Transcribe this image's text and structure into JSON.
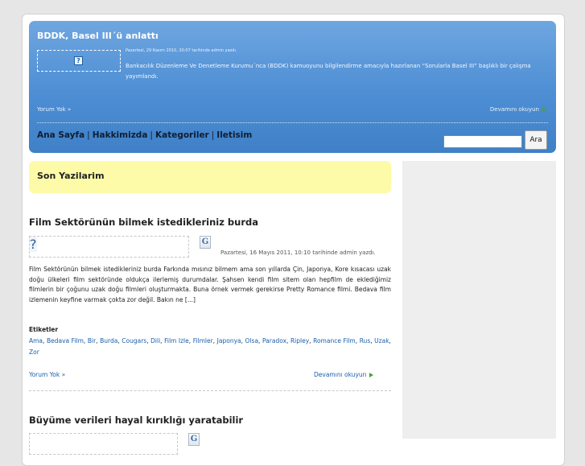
{
  "header": {
    "post_title": "BDDK, Basel III´ü anlattı",
    "post_meta": "Pazartesi, 29 Kasım 2010, 20:07 tarihinde admin yazdı.",
    "post_excerpt": "Bankacılık Düzenleme Ve Denetleme Kurumu´nca (BDDK) kamuoyunu bilgilendirme amacıyla hazırlanan “Sorularla Basel III” başlıklı bir çalışma yayımlandı.",
    "comments_link": "Yorum Yok »",
    "read_more": "Devamını okuyun",
    "image_alt_icon": "broken-image-icon"
  },
  "nav": {
    "items": [
      {
        "label": "Ana Sayfa"
      },
      {
        "label": "Hakkimizda"
      },
      {
        "label": "Kategoriler"
      },
      {
        "label": "Iletisim"
      }
    ],
    "separator": "|"
  },
  "search": {
    "value": "",
    "button_label": "Ara"
  },
  "sections": {
    "recent_title": "Son Yazilarim"
  },
  "posts": [
    {
      "title": "Film Sektörünün bilmek istedikleriniz burda",
      "meta": "Pazartesi, 16 Mayıs 2011, 10:10 tarihinde admin yazdı.",
      "excerpt": "Film Sektörünün bilmek istedikleriniz burda Farkında mısınız bilmem ama son yıllarda Çin, Japonya, Kore kısacası uzak doğu ülkeleri film sektöründe oldukça ilerlemiş durumdalar. Şahsen kendi film sitem olan hepfilm de eklediğimiz filmlerin bir çoğunu uzak doğu filmleri oluşturmakta. Buna örnek vermek gerekirse Pretty Romance filmi. Bedava film izlemenin keyfine varmak çokta zor değil. Bakın ne [...]",
      "tags_label": "Etiketler",
      "tags": [
        "Ama",
        "Bedava Film",
        "Bir",
        "Burda",
        "Cougars",
        "Dili",
        "Film Izle",
        "Filmler",
        "Japonya",
        "Olsa",
        "Paradox",
        "Ripley",
        "Romance Film",
        "Rus",
        "Uzak",
        "Zor"
      ],
      "comments_link": "Yorum Yok »",
      "read_more": "Devamını okuyun"
    },
    {
      "title": "Büyüme verileri hayal kırıklığı yaratabilir"
    }
  ],
  "colors": {
    "header_gradient_top": "#6fa6e0",
    "header_gradient_bottom": "#3f80c6",
    "recent_box": "#fdfba8",
    "link": "#1a5eab",
    "sidebar": "#eeeeee"
  }
}
